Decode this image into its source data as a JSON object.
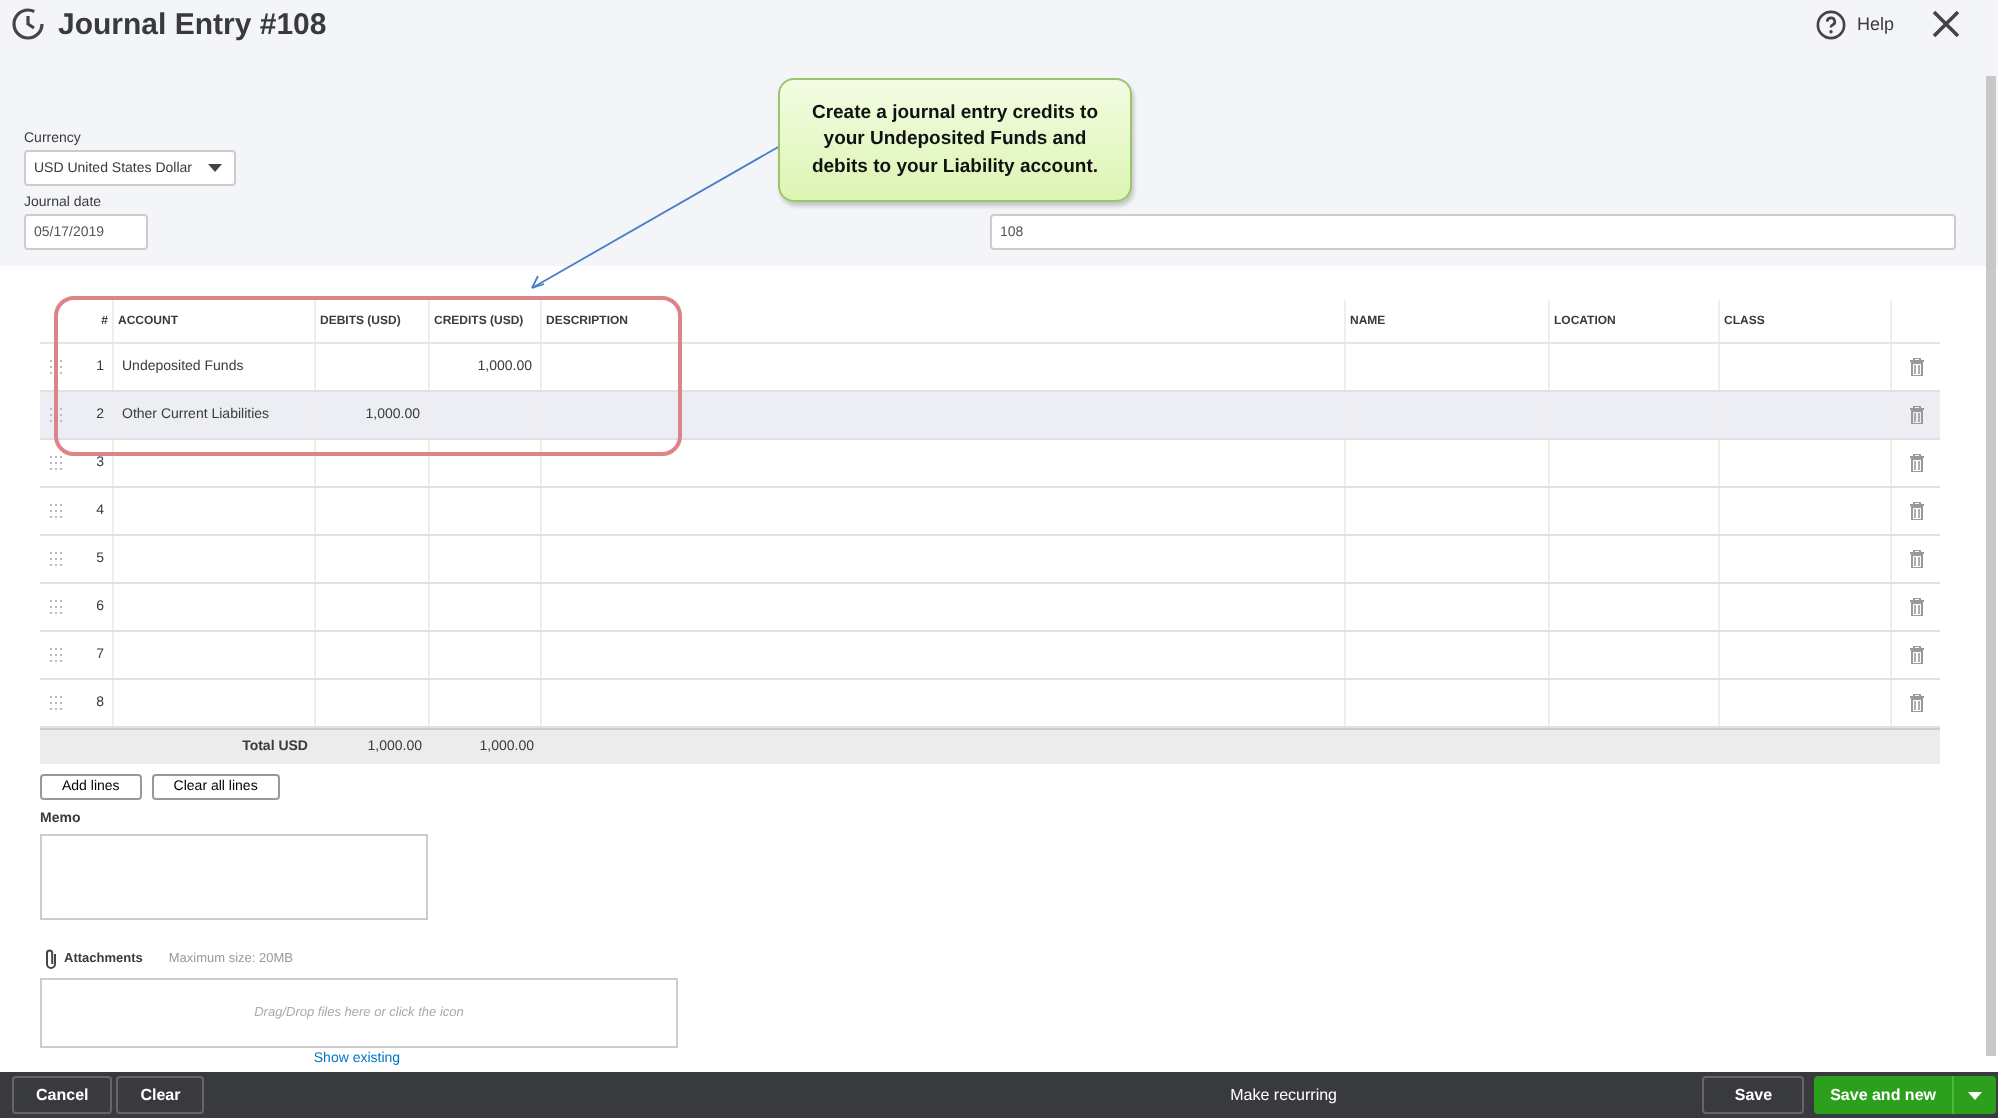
{
  "header": {
    "title": "Journal Entry #108",
    "help": "Help"
  },
  "currency": {
    "label": "Currency",
    "value": "USD United States Dollar"
  },
  "journal_date": {
    "label": "Journal date",
    "value": "05/17/2019"
  },
  "journal_no": {
    "value": "108"
  },
  "callout": {
    "text": "Create a journal entry credits to your Undeposited Funds and debits to your Liability account."
  },
  "table": {
    "columns": [
      "#",
      "ACCOUNT",
      "DEBITS (USD)",
      "CREDITS (USD)",
      "DESCRIPTION",
      "NAME",
      "LOCATION",
      "CLASS"
    ],
    "rows": [
      {
        "num": "1",
        "account": "Undeposited Funds",
        "debits": "",
        "credits": "1,000.00",
        "selected": false
      },
      {
        "num": "2",
        "account": "Other Current Liabilities",
        "debits": "1,000.00",
        "credits": "",
        "selected": true
      },
      {
        "num": "3",
        "account": "",
        "debits": "",
        "credits": "",
        "selected": false
      },
      {
        "num": "4",
        "account": "",
        "debits": "",
        "credits": "",
        "selected": false
      },
      {
        "num": "5",
        "account": "",
        "debits": "",
        "credits": "",
        "selected": false
      },
      {
        "num": "6",
        "account": "",
        "debits": "",
        "credits": "",
        "selected": false
      },
      {
        "num": "7",
        "account": "",
        "debits": "",
        "credits": "",
        "selected": false
      },
      {
        "num": "8",
        "account": "",
        "debits": "",
        "credits": "",
        "selected": false
      }
    ],
    "total": {
      "label": "Total USD",
      "debits": "1,000.00",
      "credits": "1,000.00"
    }
  },
  "buttons": [
    "Add lines",
    "Clear all lines"
  ],
  "memo": {
    "label": "Memo"
  },
  "attachments": {
    "label": "Attachments",
    "max_size": "Maximum size: 20MB",
    "drop_hint": "Drag/Drop files here or click the icon",
    "show_existing": "Show existing"
  },
  "footer": {
    "cancel": "Cancel",
    "clear": "Clear",
    "make_recurring": "Make recurring",
    "save": "Save",
    "save_and_new": "Save and new"
  }
}
